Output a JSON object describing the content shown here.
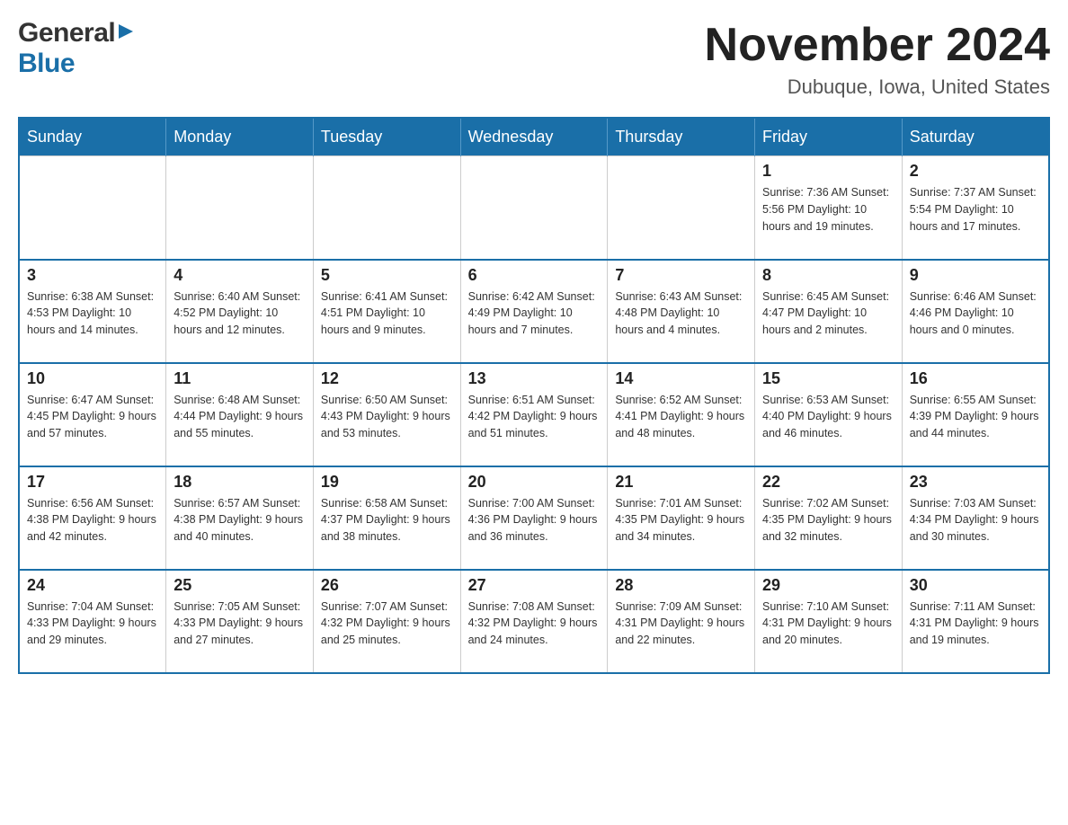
{
  "header": {
    "logo": {
      "general_text": "General",
      "blue_text": "Blue"
    },
    "title": "November 2024",
    "subtitle": "Dubuque, Iowa, United States"
  },
  "calendar": {
    "days_of_week": [
      "Sunday",
      "Monday",
      "Tuesday",
      "Wednesday",
      "Thursday",
      "Friday",
      "Saturday"
    ],
    "weeks": [
      [
        {
          "day": "",
          "info": ""
        },
        {
          "day": "",
          "info": ""
        },
        {
          "day": "",
          "info": ""
        },
        {
          "day": "",
          "info": ""
        },
        {
          "day": "",
          "info": ""
        },
        {
          "day": "1",
          "info": "Sunrise: 7:36 AM\nSunset: 5:56 PM\nDaylight: 10 hours\nand 19 minutes."
        },
        {
          "day": "2",
          "info": "Sunrise: 7:37 AM\nSunset: 5:54 PM\nDaylight: 10 hours\nand 17 minutes."
        }
      ],
      [
        {
          "day": "3",
          "info": "Sunrise: 6:38 AM\nSunset: 4:53 PM\nDaylight: 10 hours\nand 14 minutes."
        },
        {
          "day": "4",
          "info": "Sunrise: 6:40 AM\nSunset: 4:52 PM\nDaylight: 10 hours\nand 12 minutes."
        },
        {
          "day": "5",
          "info": "Sunrise: 6:41 AM\nSunset: 4:51 PM\nDaylight: 10 hours\nand 9 minutes."
        },
        {
          "day": "6",
          "info": "Sunrise: 6:42 AM\nSunset: 4:49 PM\nDaylight: 10 hours\nand 7 minutes."
        },
        {
          "day": "7",
          "info": "Sunrise: 6:43 AM\nSunset: 4:48 PM\nDaylight: 10 hours\nand 4 minutes."
        },
        {
          "day": "8",
          "info": "Sunrise: 6:45 AM\nSunset: 4:47 PM\nDaylight: 10 hours\nand 2 minutes."
        },
        {
          "day": "9",
          "info": "Sunrise: 6:46 AM\nSunset: 4:46 PM\nDaylight: 10 hours\nand 0 minutes."
        }
      ],
      [
        {
          "day": "10",
          "info": "Sunrise: 6:47 AM\nSunset: 4:45 PM\nDaylight: 9 hours\nand 57 minutes."
        },
        {
          "day": "11",
          "info": "Sunrise: 6:48 AM\nSunset: 4:44 PM\nDaylight: 9 hours\nand 55 minutes."
        },
        {
          "day": "12",
          "info": "Sunrise: 6:50 AM\nSunset: 4:43 PM\nDaylight: 9 hours\nand 53 minutes."
        },
        {
          "day": "13",
          "info": "Sunrise: 6:51 AM\nSunset: 4:42 PM\nDaylight: 9 hours\nand 51 minutes."
        },
        {
          "day": "14",
          "info": "Sunrise: 6:52 AM\nSunset: 4:41 PM\nDaylight: 9 hours\nand 48 minutes."
        },
        {
          "day": "15",
          "info": "Sunrise: 6:53 AM\nSunset: 4:40 PM\nDaylight: 9 hours\nand 46 minutes."
        },
        {
          "day": "16",
          "info": "Sunrise: 6:55 AM\nSunset: 4:39 PM\nDaylight: 9 hours\nand 44 minutes."
        }
      ],
      [
        {
          "day": "17",
          "info": "Sunrise: 6:56 AM\nSunset: 4:38 PM\nDaylight: 9 hours\nand 42 minutes."
        },
        {
          "day": "18",
          "info": "Sunrise: 6:57 AM\nSunset: 4:38 PM\nDaylight: 9 hours\nand 40 minutes."
        },
        {
          "day": "19",
          "info": "Sunrise: 6:58 AM\nSunset: 4:37 PM\nDaylight: 9 hours\nand 38 minutes."
        },
        {
          "day": "20",
          "info": "Sunrise: 7:00 AM\nSunset: 4:36 PM\nDaylight: 9 hours\nand 36 minutes."
        },
        {
          "day": "21",
          "info": "Sunrise: 7:01 AM\nSunset: 4:35 PM\nDaylight: 9 hours\nand 34 minutes."
        },
        {
          "day": "22",
          "info": "Sunrise: 7:02 AM\nSunset: 4:35 PM\nDaylight: 9 hours\nand 32 minutes."
        },
        {
          "day": "23",
          "info": "Sunrise: 7:03 AM\nSunset: 4:34 PM\nDaylight: 9 hours\nand 30 minutes."
        }
      ],
      [
        {
          "day": "24",
          "info": "Sunrise: 7:04 AM\nSunset: 4:33 PM\nDaylight: 9 hours\nand 29 minutes."
        },
        {
          "day": "25",
          "info": "Sunrise: 7:05 AM\nSunset: 4:33 PM\nDaylight: 9 hours\nand 27 minutes."
        },
        {
          "day": "26",
          "info": "Sunrise: 7:07 AM\nSunset: 4:32 PM\nDaylight: 9 hours\nand 25 minutes."
        },
        {
          "day": "27",
          "info": "Sunrise: 7:08 AM\nSunset: 4:32 PM\nDaylight: 9 hours\nand 24 minutes."
        },
        {
          "day": "28",
          "info": "Sunrise: 7:09 AM\nSunset: 4:31 PM\nDaylight: 9 hours\nand 22 minutes."
        },
        {
          "day": "29",
          "info": "Sunrise: 7:10 AM\nSunset: 4:31 PM\nDaylight: 9 hours\nand 20 minutes."
        },
        {
          "day": "30",
          "info": "Sunrise: 7:11 AM\nSunset: 4:31 PM\nDaylight: 9 hours\nand 19 minutes."
        }
      ]
    ]
  }
}
